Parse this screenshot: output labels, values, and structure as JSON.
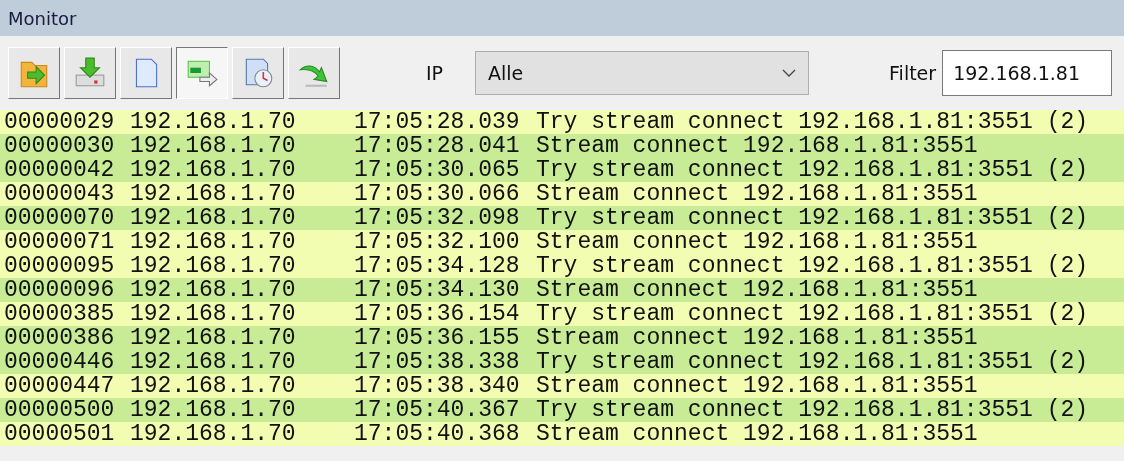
{
  "window": {
    "title": "Monitor"
  },
  "toolbar": [
    {
      "kind": "open",
      "selected": false
    },
    {
      "kind": "download",
      "selected": false
    },
    {
      "kind": "page",
      "selected": false
    },
    {
      "kind": "screen",
      "selected": true
    },
    {
      "kind": "clock",
      "selected": false
    },
    {
      "kind": "arrow",
      "selected": false
    }
  ],
  "ip": {
    "label": "IP",
    "value": "Alle"
  },
  "filter": {
    "label": "Filter",
    "value": "192.168.1.81"
  },
  "rows": [
    {
      "id": "00000029",
      "ip": "192.168.1.70",
      "time": "17:05:28.039",
      "message": "Try stream connect 192.168.1.81:3551 (2)",
      "color": "#f2fdb2"
    },
    {
      "id": "00000030",
      "ip": "192.168.1.70",
      "time": "17:05:28.041",
      "message": "Stream connect 192.168.1.81:3551",
      "color": "#c8ec96"
    },
    {
      "id": "00000042",
      "ip": "192.168.1.70",
      "time": "17:05:30.065",
      "message": "Try stream connect 192.168.1.81:3551 (2)",
      "color": "#c8ec96"
    },
    {
      "id": "00000043",
      "ip": "192.168.1.70",
      "time": "17:05:30.066",
      "message": "Stream connect 192.168.1.81:3551",
      "color": "#f2fdb2"
    },
    {
      "id": "00000070",
      "ip": "192.168.1.70",
      "time": "17:05:32.098",
      "message": "Try stream connect 192.168.1.81:3551 (2)",
      "color": "#c8ec96"
    },
    {
      "id": "00000071",
      "ip": "192.168.1.70",
      "time": "17:05:32.100",
      "message": "Stream connect 192.168.1.81:3551",
      "color": "#f2fdb2"
    },
    {
      "id": "00000095",
      "ip": "192.168.1.70",
      "time": "17:05:34.128",
      "message": "Try stream connect 192.168.1.81:3551 (2)",
      "color": "#f2fdb2"
    },
    {
      "id": "00000096",
      "ip": "192.168.1.70",
      "time": "17:05:34.130",
      "message": "Stream connect 192.168.1.81:3551",
      "color": "#c8ec96"
    },
    {
      "id": "00000385",
      "ip": "192.168.1.70",
      "time": "17:05:36.154",
      "message": "Try stream connect 192.168.1.81:3551 (2)",
      "color": "#f2fdb2"
    },
    {
      "id": "00000386",
      "ip": "192.168.1.70",
      "time": "17:05:36.155",
      "message": "Stream connect 192.168.1.81:3551",
      "color": "#c8ec96"
    },
    {
      "id": "00000446",
      "ip": "192.168.1.70",
      "time": "17:05:38.338",
      "message": "Try stream connect 192.168.1.81:3551 (2)",
      "color": "#c8ec96"
    },
    {
      "id": "00000447",
      "ip": "192.168.1.70",
      "time": "17:05:38.340",
      "message": "Stream connect 192.168.1.81:3551",
      "color": "#f2fdb2"
    },
    {
      "id": "00000500",
      "ip": "192.168.1.70",
      "time": "17:05:40.367",
      "message": "Try stream connect 192.168.1.81:3551 (2)",
      "color": "#c8ec96"
    },
    {
      "id": "00000501",
      "ip": "192.168.1.70",
      "time": "17:05:40.368",
      "message": "Stream connect 192.168.1.81:3551",
      "color": "#f2fdb2"
    }
  ]
}
